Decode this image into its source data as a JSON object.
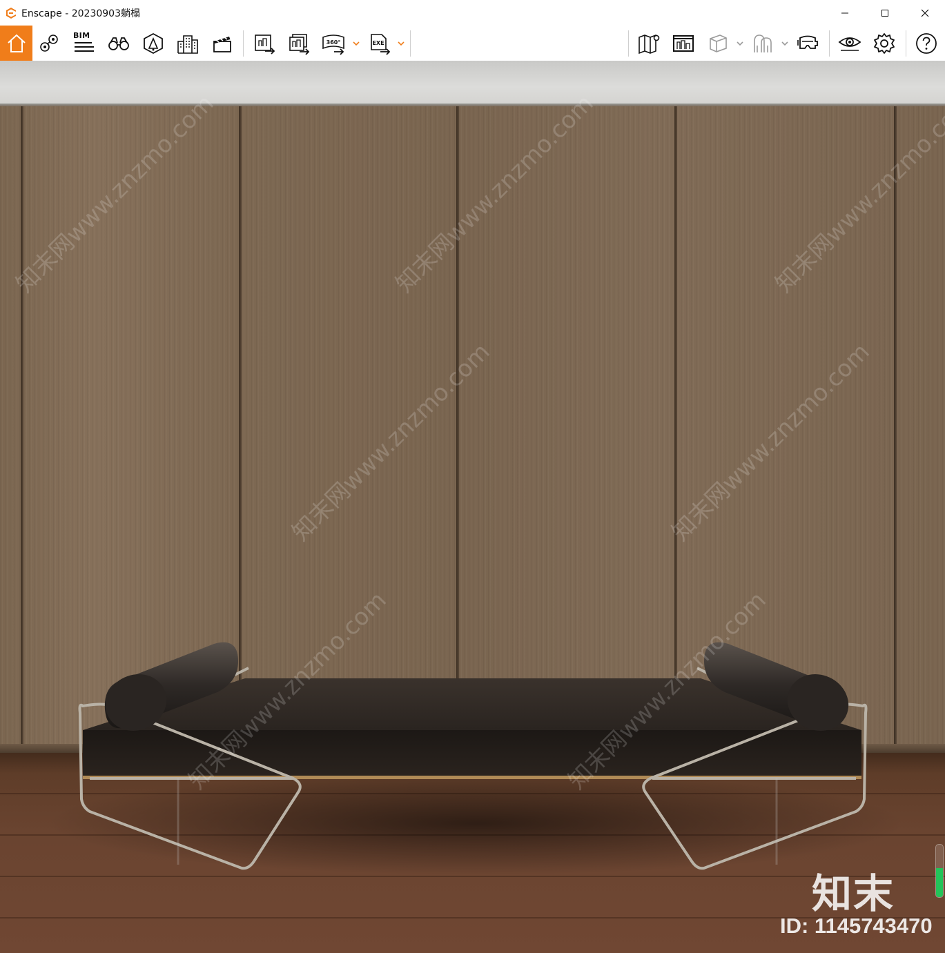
{
  "window": {
    "title": "Enscape - 20230903躺榻",
    "app_icon": "enscape-logo-icon",
    "controls": [
      "minimize-icon",
      "maximize-icon",
      "close-icon"
    ]
  },
  "toolbar": {
    "accent_color": "#f07d1a",
    "bim_label": "BIM",
    "left_tools": [
      "home-icon",
      "location-pin-icon",
      "bim-icon",
      "binoculars-icon",
      "asset-library-icon",
      "buildings-icon",
      "clapperboard-icon"
    ],
    "export_tools": [
      "export-image-icon",
      "batch-export-icon",
      "export-360-icon",
      "export-exe-icon"
    ],
    "right_tools": [
      "map-icon",
      "media-icon",
      "cube-view-icon",
      "people-icon",
      "vr-headset-icon",
      "visibility-eye-icon",
      "settings-gear-icon",
      "help-icon"
    ],
    "label_360": "360°",
    "label_exe": "EXE"
  },
  "viewport": {
    "watermark_text": "知末网www.znzmo.com",
    "brand_mark": "知末",
    "asset_id": "ID: 1145743470",
    "render_progress_fraction": 0.55,
    "progress_color": "#23c45a"
  }
}
